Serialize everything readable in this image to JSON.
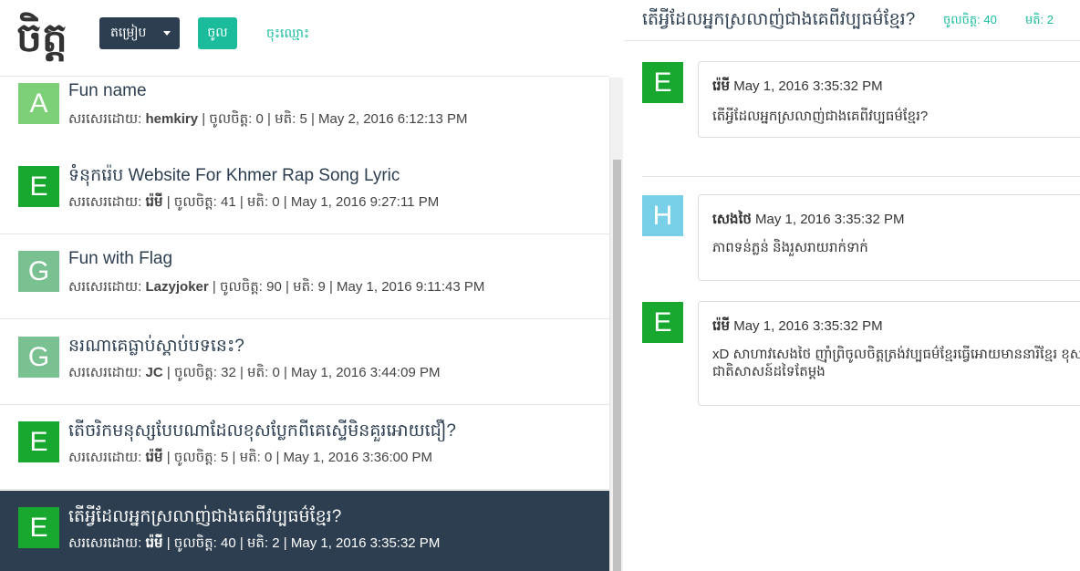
{
  "header": {
    "logo": "ចិត្ត",
    "sort_label": "តម្រៀប",
    "login_label": "ចូល",
    "register_label": "ចុះឈ្មោះ"
  },
  "meta_labels": {
    "author": "សរសេរដោយ:",
    "likes": "ចូលចិត្ត:",
    "views": "មតិ:"
  },
  "posts": [
    {
      "avatar": "A",
      "avatar_color": "#7dd077",
      "title": "Fun name",
      "author": "hemkiry",
      "likes": "0",
      "views": "5",
      "date": "May 2, 2016 6:12:13 PM"
    },
    {
      "avatar": "E",
      "avatar_color": "#18a82f",
      "title": "ទំនុករ៉េប Website For Khmer Rap Song Lyric",
      "author": "រ៉េមី",
      "likes": "41",
      "views": "0",
      "date": "May 1, 2016 9:27:11 PM"
    },
    {
      "avatar": "G",
      "avatar_color": "#79c190",
      "title": "Fun with Flag",
      "author": "Lazyjoker",
      "likes": "90",
      "views": "9",
      "date": "May 1, 2016 9:11:43 PM"
    },
    {
      "avatar": "G",
      "avatar_color": "#79c190",
      "title": "នរណាគេធ្លាប់ស្តាប់បទនេះ?",
      "author": "JC",
      "likes": "32",
      "views": "0",
      "date": "May 1, 2016 3:44:09 PM"
    },
    {
      "avatar": "E",
      "avatar_color": "#18a82f",
      "title": "តើចរិកមនុស្សបែបណាដែលខុសប្លែកពីគេស្ទើមិនគួរអោយជឿ?",
      "author": "រ៉េមី",
      "likes": "5",
      "views": "0",
      "date": "May 1, 2016 3:36:00 PM"
    },
    {
      "avatar": "E",
      "avatar_color": "#18a82f",
      "title": "តើអ្វីដែលអ្នកស្រលាញ់ជាងគេពីវប្បធម៌ខ្មែរ?",
      "author": "រ៉េមី",
      "likes": "40",
      "views": "2",
      "date": "May 1, 2016 3:35:32 PM",
      "active": true
    }
  ],
  "detail": {
    "title": "តើអ្វីដែលអ្នកស្រលាញ់ជាងគេពីវប្បធម៌ខ្មែរ?",
    "likes_text": "ចូលចិត្ត: 40",
    "views_text": "មតិ: 2"
  },
  "comments": [
    {
      "avatar": "E",
      "avatar_color": "#18a82f",
      "author": "រ៉េមី",
      "date": "May 1, 2016 3:35:32 PM",
      "text": "តើអ្វីដែលអ្នកស្រលាញ់ជាងគេពីវប្បធម៌ខ្មែរ?"
    },
    {
      "avatar": "H",
      "avatar_color": "#77d0e8",
      "author": "សេងថៃ",
      "date": "May 1, 2016 3:35:32 PM",
      "text": "ភាពទន់ភ្លន់ និងរួសរាយរាក់ទាក់"
    },
    {
      "avatar": "E",
      "avatar_color": "#18a82f",
      "author": "រ៉េមី",
      "date": "May 1, 2016 3:35:32 PM",
      "text": "xD សាហាវសេងថៃ ញ៉ាំព្រិចូលចិត្តត្រង់វប្បធម៌ខ្មែរធ្វើអោយមាននារីខ្មែរ ខុសពីជាតិសាសន៍ដទៃតែម្តង"
    }
  ]
}
